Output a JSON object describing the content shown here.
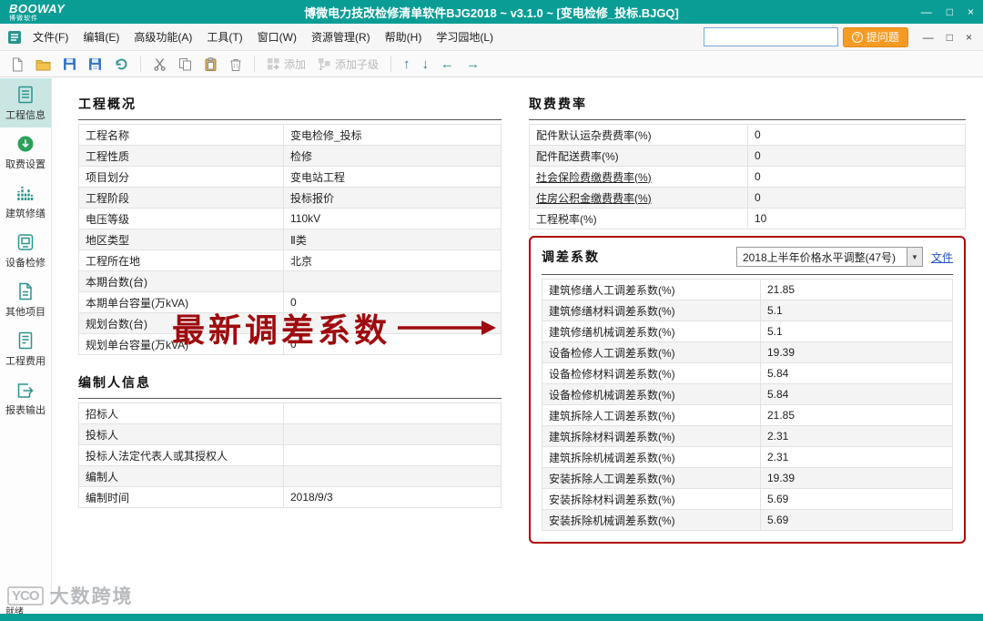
{
  "icons": {
    "minimize": "—",
    "maximize": "□",
    "close": "×",
    "restore": "□",
    "caret_down": "▼",
    "arrow_up": "↑",
    "arrow_down": "↓",
    "arrow_left": "←",
    "arrow_right": "→",
    "question": "?"
  },
  "colors": {
    "teal": "#0a9d96",
    "orange": "#f59a23",
    "red_annotation": "#9e0b0f",
    "link_blue": "#2353c8"
  },
  "titlebar": {
    "logo": "BOOWAY",
    "logo_sub": "博微软件",
    "title": "博微电力技改检修清单软件BJG2018 ~ v3.1.0 ~ [变电检修_投标.BJGQ]"
  },
  "menubar": {
    "items": [
      "文件(F)",
      "编辑(E)",
      "高级功能(A)",
      "工具(T)",
      "窗口(W)",
      "资源管理(R)",
      "帮助(H)",
      "学习园地(L)"
    ],
    "search_value": "",
    "ask_button": "提问题"
  },
  "toolbar": {
    "add_label": "添加",
    "add_child_label": "添加子级"
  },
  "sidebar": {
    "items": [
      {
        "label": "工程信息",
        "active": true
      },
      {
        "label": "取费设置",
        "active": false
      },
      {
        "label": "建筑修缮",
        "active": false
      },
      {
        "label": "设备检修",
        "active": false
      },
      {
        "label": "其他项目",
        "active": false
      },
      {
        "label": "工程费用",
        "active": false
      },
      {
        "label": "报表输出",
        "active": false
      }
    ]
  },
  "project_overview": {
    "title": "工程概况",
    "rows": [
      {
        "label": "工程名称",
        "value": "变电检修_投标"
      },
      {
        "label": "工程性质",
        "value": "检修"
      },
      {
        "label": "项目划分",
        "value": "变电站工程"
      },
      {
        "label": "工程阶段",
        "value": "投标报价"
      },
      {
        "label": "电压等级",
        "value": "110kV"
      },
      {
        "label": "地区类型",
        "value": "Ⅱ类"
      },
      {
        "label": "工程所在地",
        "value": "北京"
      },
      {
        "label": "本期台数(台)",
        "value": ""
      },
      {
        "label": "本期单台容量(万kVA)",
        "value": "0"
      },
      {
        "label": "规划台数(台)",
        "value": ""
      },
      {
        "label": "规划单台容量(万kVA)",
        "value": "0"
      }
    ]
  },
  "compiler_info": {
    "title": "编制人信息",
    "rows": [
      {
        "label": "招标人",
        "value": ""
      },
      {
        "label": "投标人",
        "value": ""
      },
      {
        "label": "投标人法定代表人或其授权人",
        "value": ""
      },
      {
        "label": "编制人",
        "value": ""
      },
      {
        "label": "编制时间",
        "value": "2018/9/3"
      }
    ]
  },
  "fee_rates": {
    "title": "取费费率",
    "rows": [
      {
        "label": "配件默认运杂费费率(%)",
        "value": "0",
        "value_blue": true
      },
      {
        "label": "配件配送费率(%)",
        "value": "0",
        "value_blue": true
      },
      {
        "label": "社会保险费缴费费率(%)",
        "value": "0",
        "label_link": true
      },
      {
        "label": "住房公积金缴费费率(%)",
        "value": "0",
        "label_link": true
      },
      {
        "label": "工程税率(%)",
        "value": "10"
      }
    ]
  },
  "adjustment": {
    "title": "调差系数",
    "dropdown_value": "2018上半年价格水平调整(47号)",
    "file_link": "文件",
    "rows": [
      {
        "label": "建筑修缮人工调差系数(%)",
        "value": "21.85"
      },
      {
        "label": "建筑修缮材料调差系数(%)",
        "value": "5.1"
      },
      {
        "label": "建筑修缮机械调差系数(%)",
        "value": "5.1"
      },
      {
        "label": "设备检修人工调差系数(%)",
        "value": "19.39"
      },
      {
        "label": "设备检修材料调差系数(%)",
        "value": "5.84"
      },
      {
        "label": "设备检修机械调差系数(%)",
        "value": "5.84"
      },
      {
        "label": "建筑拆除人工调差系数(%)",
        "value": "21.85"
      },
      {
        "label": "建筑拆除材料调差系数(%)",
        "value": "2.31"
      },
      {
        "label": "建筑拆除机械调差系数(%)",
        "value": "2.31"
      },
      {
        "label": "安装拆除人工调差系数(%)",
        "value": "19.39"
      },
      {
        "label": "安装拆除材料调差系数(%)",
        "value": "5.69"
      },
      {
        "label": "安装拆除机械调差系数(%)",
        "value": "5.69"
      }
    ]
  },
  "annotation": {
    "text": "最新调差系数"
  },
  "statusbar": {
    "ready": "就绪"
  },
  "watermark": {
    "logo": "YCO",
    "text": "大数跨境"
  }
}
